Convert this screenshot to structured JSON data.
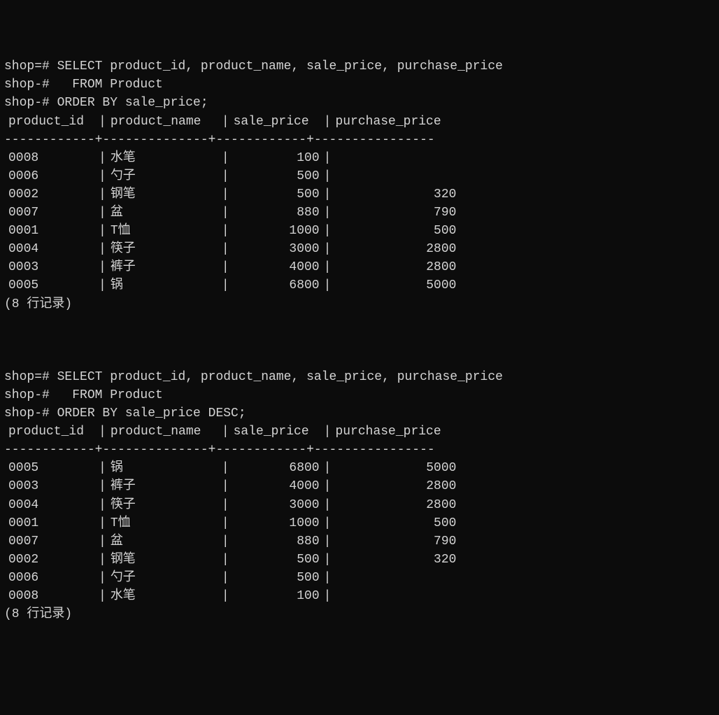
{
  "queries": [
    {
      "lines": [
        "shop=# SELECT product_id, product_name, sale_price, purchase_price",
        "shop-#   FROM Product",
        "shop-# ORDER BY sale_price;"
      ],
      "headers": [
        "product_id",
        "product_name",
        "sale_price",
        "purchase_price"
      ],
      "rows": [
        {
          "product_id": "0008",
          "product_name": "水笔",
          "sale_price": "100",
          "purchase_price": ""
        },
        {
          "product_id": "0006",
          "product_name": "勺子",
          "sale_price": "500",
          "purchase_price": ""
        },
        {
          "product_id": "0002",
          "product_name": "钢笔",
          "sale_price": "500",
          "purchase_price": "320"
        },
        {
          "product_id": "0007",
          "product_name": "盆",
          "sale_price": "880",
          "purchase_price": "790"
        },
        {
          "product_id": "0001",
          "product_name": "T恤",
          "sale_price": "1000",
          "purchase_price": "500"
        },
        {
          "product_id": "0004",
          "product_name": "筷子",
          "sale_price": "3000",
          "purchase_price": "2800"
        },
        {
          "product_id": "0003",
          "product_name": "裤子",
          "sale_price": "4000",
          "purchase_price": "2800"
        },
        {
          "product_id": "0005",
          "product_name": "锅",
          "sale_price": "6800",
          "purchase_price": "5000"
        }
      ],
      "footer": "(8 行记录)"
    },
    {
      "lines": [
        "shop=# SELECT product_id, product_name, sale_price, purchase_price",
        "shop-#   FROM Product",
        "shop-# ORDER BY sale_price DESC;"
      ],
      "headers": [
        "product_id",
        "product_name",
        "sale_price",
        "purchase_price"
      ],
      "rows": [
        {
          "product_id": "0005",
          "product_name": "锅",
          "sale_price": "6800",
          "purchase_price": "5000"
        },
        {
          "product_id": "0003",
          "product_name": "裤子",
          "sale_price": "4000",
          "purchase_price": "2800"
        },
        {
          "product_id": "0004",
          "product_name": "筷子",
          "sale_price": "3000",
          "purchase_price": "2800"
        },
        {
          "product_id": "0001",
          "product_name": "T恤",
          "sale_price": "1000",
          "purchase_price": "500"
        },
        {
          "product_id": "0007",
          "product_name": "盆",
          "sale_price": "880",
          "purchase_price": "790"
        },
        {
          "product_id": "0002",
          "product_name": "钢笔",
          "sale_price": "500",
          "purchase_price": "320"
        },
        {
          "product_id": "0006",
          "product_name": "勺子",
          "sale_price": "500",
          "purchase_price": ""
        },
        {
          "product_id": "0008",
          "product_name": "水笔",
          "sale_price": "100",
          "purchase_price": ""
        }
      ],
      "footer": "(8 行记录)"
    }
  ],
  "separator_line": "------------+--------------+------------+----------------"
}
